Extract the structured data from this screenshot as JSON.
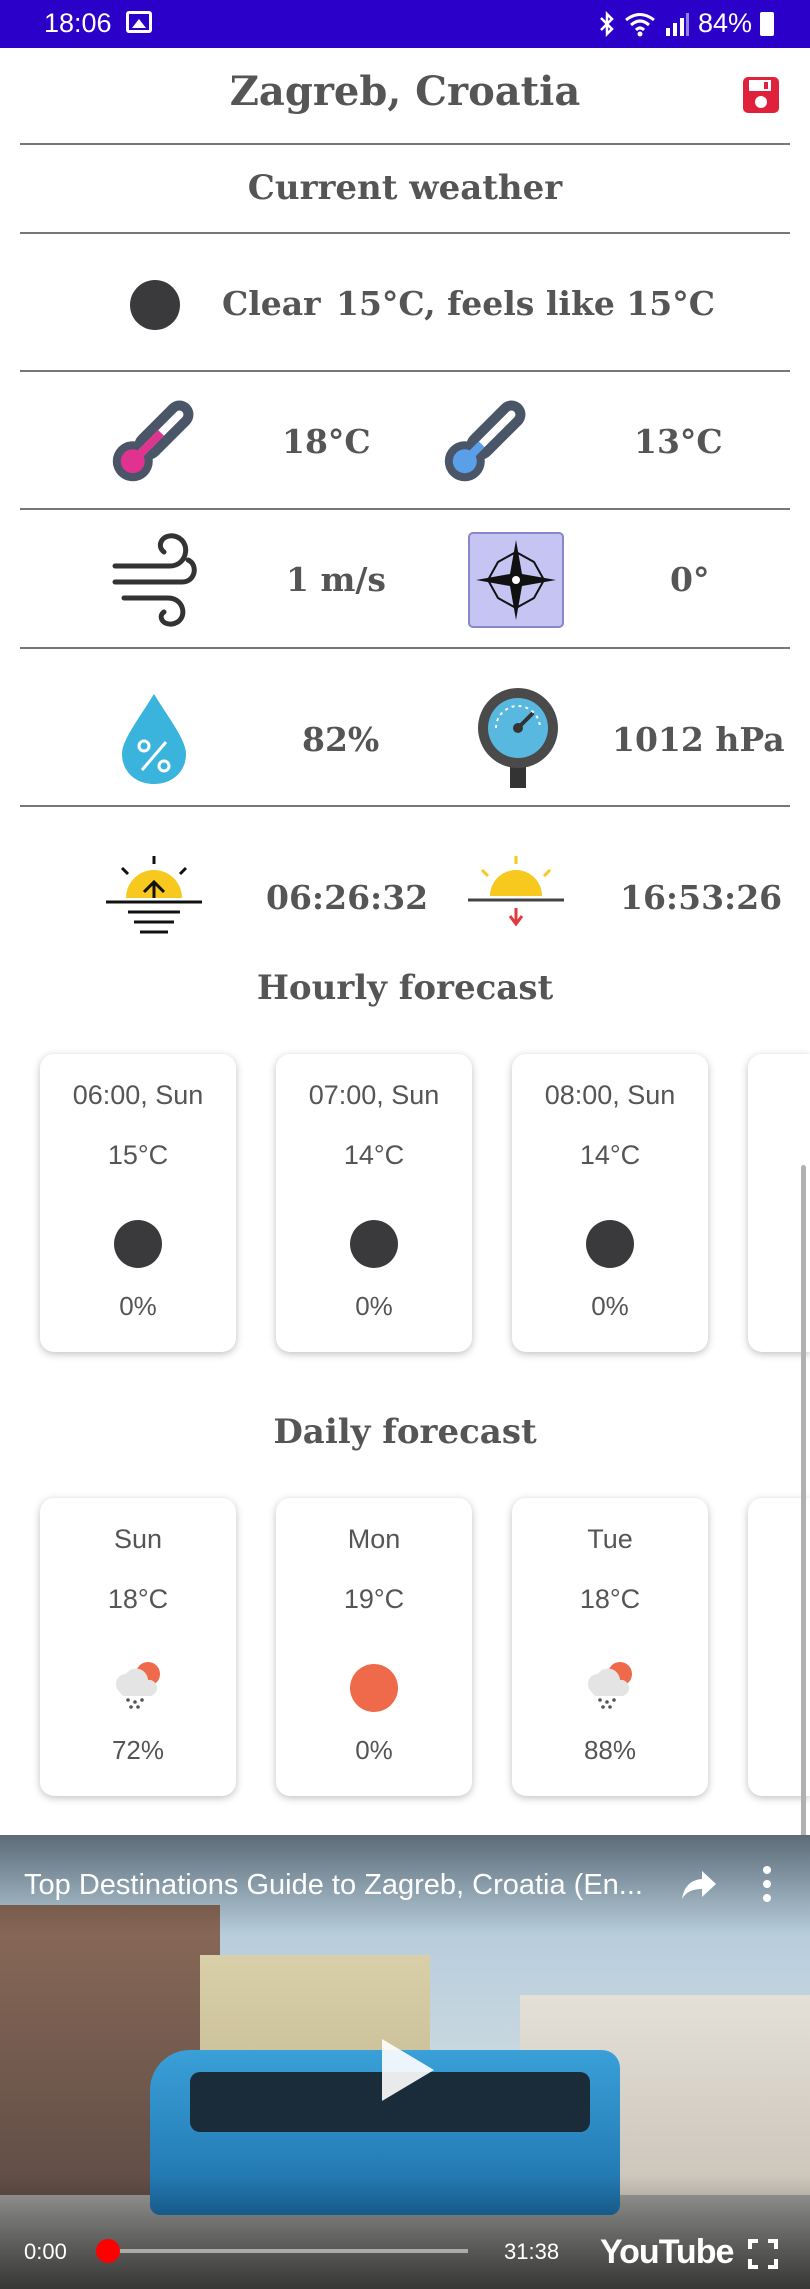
{
  "status_bar": {
    "time": "18:06",
    "battery": "84%",
    "icons": [
      "image-icon",
      "bluetooth-icon",
      "wifi-icon",
      "signal-icon",
      "battery-icon"
    ]
  },
  "header": {
    "title": "Zagreb, Croatia",
    "save_icon": "save-icon",
    "accent_color": "#e0213b"
  },
  "current": {
    "title": "Current weather",
    "condition": "Clear",
    "temp_text": "15°C, feels like 15°C",
    "temp_max": "18°C",
    "temp_min": "13°C",
    "wind_speed": "1 m/s",
    "wind_direction": "0°",
    "humidity": "82%",
    "pressure": "1012 hPa",
    "sunrise": "06:26:32",
    "sunset": "16:53:26"
  },
  "hourly": {
    "title": "Hourly forecast",
    "items": [
      {
        "time": "06:00, Sun",
        "temp": "15°C",
        "precip": "0%"
      },
      {
        "time": "07:00, Sun",
        "temp": "14°C",
        "precip": "0%"
      },
      {
        "time": "08:00, Sun",
        "temp": "14°C",
        "precip": "0%"
      }
    ]
  },
  "daily": {
    "title": "Daily forecast",
    "items": [
      {
        "day": "Sun",
        "temp": "18°C",
        "precip": "72%",
        "icon": "rain-cloud-icon"
      },
      {
        "day": "Mon",
        "temp": "19°C",
        "precip": "0%",
        "icon": "sun-icon"
      },
      {
        "day": "Tue",
        "temp": "18°C",
        "precip": "88%",
        "icon": "rain-cloud-icon"
      }
    ]
  },
  "video": {
    "title": "Top Destinations Guide to Zagreb, Croatia (En...",
    "current_time": "0:00",
    "duration": "31:38",
    "logo": "YouTube"
  }
}
